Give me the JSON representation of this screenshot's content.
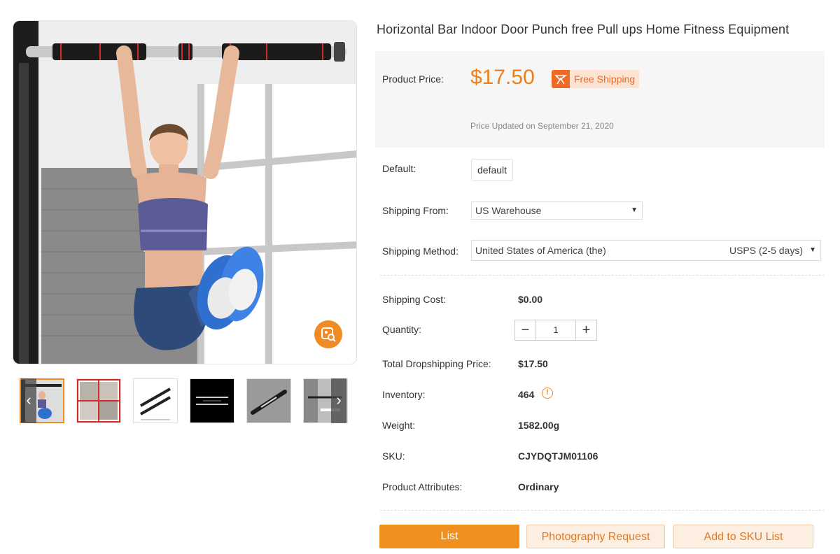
{
  "product": {
    "title": "Horizontal Bar Indoor Door Punch free Pull ups Home Fitness Equipment"
  },
  "gallery": {
    "thumbnails": [
      {
        "name": "thumb-woman-hanging",
        "active": true
      },
      {
        "name": "thumb-usage-collage",
        "active": false
      },
      {
        "name": "thumb-bar-parts",
        "active": false
      },
      {
        "name": "thumb-dimensions",
        "active": false
      },
      {
        "name": "thumb-bar-gray",
        "active": false
      },
      {
        "name": "thumb-install",
        "active": false
      }
    ],
    "prev_arrow": "‹",
    "next_arrow": "›"
  },
  "pricing": {
    "price_label": "Product Price:",
    "price": "$17.50",
    "free_shipping": "Free Shipping",
    "updated": "Price Updated on September 21, 2020"
  },
  "options": {
    "default_label": "Default:",
    "default_value": "default",
    "ship_from_label": "Shipping From:",
    "ship_from_value": "US Warehouse",
    "ship_method_label": "Shipping Method:",
    "ship_method_country": "United States of America (the)",
    "ship_method_service": "USPS (2-5 days)"
  },
  "details": {
    "shipping_cost_label": "Shipping Cost:",
    "shipping_cost": "$0.00",
    "quantity_label": "Quantity:",
    "quantity": "1",
    "minus": "−",
    "plus": "+",
    "total_label": "Total Dropshipping Price:",
    "total": "$17.50",
    "inventory_label": "Inventory:",
    "inventory": "464",
    "inventory_warn": "!",
    "weight_label": "Weight:",
    "weight": "1582.00g",
    "sku_label": "SKU:",
    "sku": "CJYDQTJM01106",
    "attributes_label": "Product Attributes:",
    "attributes": "Ordinary"
  },
  "actions": {
    "list": "List",
    "photography": "Photography Request",
    "add_sku": "Add to SKU List"
  },
  "colors": {
    "accent": "#f08a24",
    "price": "#f07f1a",
    "free_ship_bg": "#fde3d2"
  }
}
